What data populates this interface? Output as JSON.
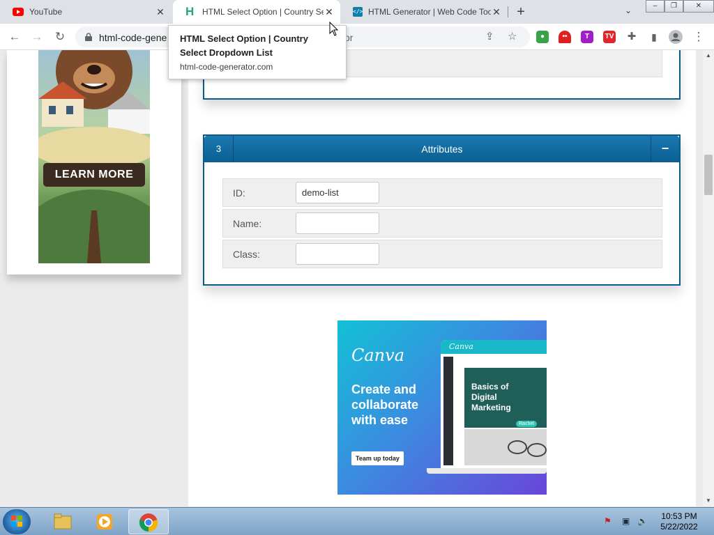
{
  "browser": {
    "tabs": [
      {
        "title": "YouTube",
        "icon": "youtube-icon"
      },
      {
        "title": "HTML Select Option | Country Se",
        "icon": "html-code-generator-icon"
      },
      {
        "title": "HTML Generator | Web Code Too",
        "icon": "code-icon"
      }
    ],
    "hover_card": {
      "title": "HTML Select Option | Country Select Dropdown List",
      "url": "html-code-generator.com"
    },
    "address": {
      "text": "html-code-gene",
      "tail": "or"
    },
    "new_tab": "+",
    "window_controls": {
      "minimize": "–",
      "restore": "❐",
      "close": "✕"
    }
  },
  "page": {
    "sidebar_ad": {
      "cta": "LEARN MORE"
    },
    "attributes_panel": {
      "number": "3",
      "title": "Attributes",
      "toggle": "−",
      "fields": [
        {
          "label": "ID:",
          "value": "demo-list"
        },
        {
          "label": "Name:",
          "value": ""
        },
        {
          "label": "Class:",
          "value": ""
        }
      ]
    },
    "canva_ad": {
      "logo": "Canva",
      "headline": "Create and collaborate with ease",
      "cta": "Team up today",
      "card_text": "Basics of Digital Marketing",
      "tag": "Rachel",
      "mini_logo": "Canva"
    }
  },
  "taskbar": {
    "time": "10:53 PM",
    "date": "5/22/2022"
  },
  "colors": {
    "panel_header": "#0b5f92",
    "panel_border": "#0b5b87",
    "row_background": "#efefef"
  }
}
